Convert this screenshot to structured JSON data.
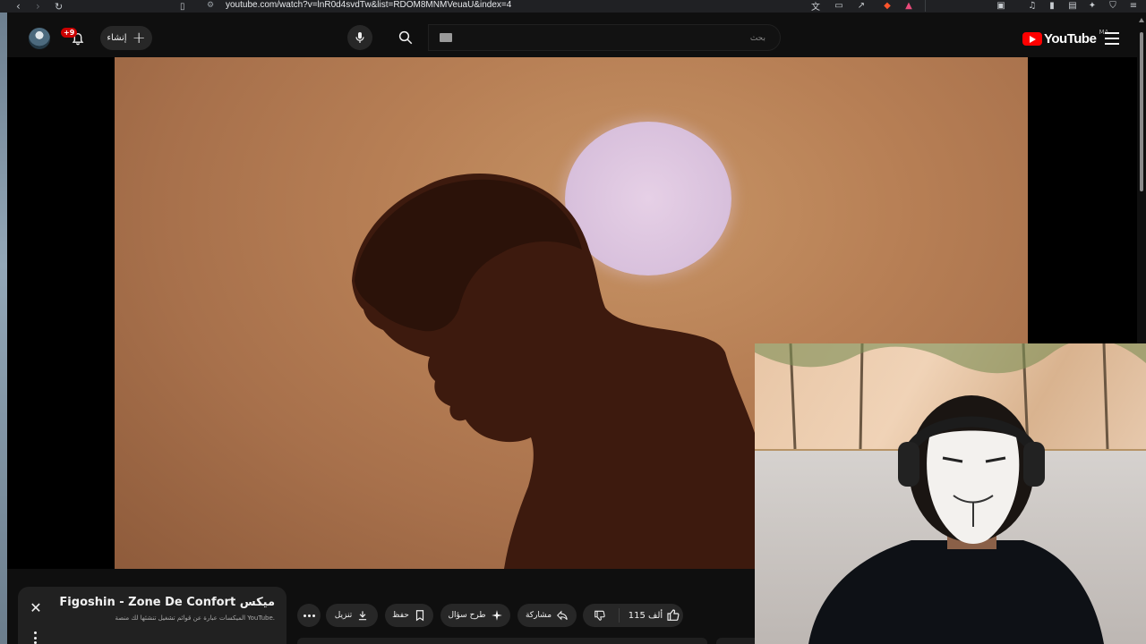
{
  "browser": {
    "url": "youtube.com/watch?v=lnR0d4svdTw&list=RDOM8MNMVeuaU&index=4"
  },
  "header": {
    "create_label": "إنشاء",
    "notification_count": "+9",
    "search_placeholder": "بحث",
    "logo_text": "YouTube",
    "country_code": "MA"
  },
  "mix_panel": {
    "title": "Figoshin - Zone De Confort ميكس",
    "subtitle": "الميكسات عبارة عن قوائم تشغيل تنشئها لك منصة YouTube."
  },
  "actions": {
    "like_count": "115 ألف",
    "share_label": "مشاركة",
    "ask_label": "طرح سؤال",
    "save_label": "حفظ",
    "download_label": "تنزيل"
  },
  "colors": {
    "background": "#0f0f0f",
    "pill": "#272727",
    "brand_red": "#ff0000",
    "badge_red": "#cc0000"
  }
}
